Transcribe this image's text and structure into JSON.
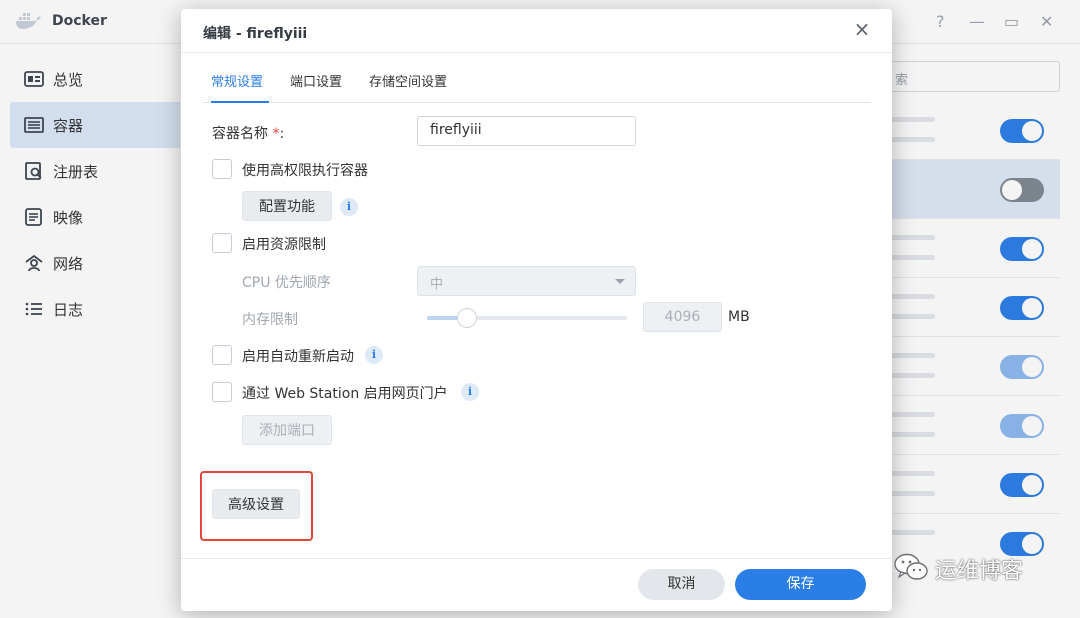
{
  "app": {
    "title": "Docker",
    "sidebar": {
      "items": [
        {
          "label": "总览",
          "icon": "dashboard-icon"
        },
        {
          "label": "容器",
          "icon": "container-icon",
          "active": true
        },
        {
          "label": "注册表",
          "icon": "registry-icon"
        },
        {
          "label": "映像",
          "icon": "image-icon"
        },
        {
          "label": "网络",
          "icon": "network-icon"
        },
        {
          "label": "日志",
          "icon": "log-icon"
        }
      ]
    },
    "search": {
      "placeholder": "索"
    },
    "window_controls": [
      "?",
      "—",
      "▭",
      "✕"
    ],
    "list_toggles": [
      "on",
      "off",
      "on",
      "on",
      "on-dim",
      "on-dim",
      "on",
      "on"
    ]
  },
  "dialog": {
    "title": "编辑 - fireflyiii",
    "tabs": [
      {
        "label": "常规设置",
        "active": true
      },
      {
        "label": "端口设置"
      },
      {
        "label": "存储空间设置"
      }
    ],
    "container_name_label": "容器名称",
    "required_mark": "*",
    "label_suffix": ":",
    "container_name_value": "fireflyiii",
    "privileged_label": "使用高权限执行容器",
    "configure_button": "配置功能",
    "resource_limit_label": "启用资源限制",
    "cpu_priority_label": "CPU 优先顺序",
    "cpu_priority_value": "中",
    "memory_limit_label": "内存限制",
    "memory_value": "4096",
    "memory_unit": "MB",
    "auto_restart_label": "启用自动重新启动",
    "web_station_label": "通过 Web Station 启用网页门户",
    "add_port_button": "添加端口",
    "advanced_button": "高级设置",
    "cancel_button": "取消",
    "save_button": "保存",
    "info_glyph": "i",
    "close_glyph": "×"
  },
  "watermark": {
    "text": "运维博客"
  }
}
